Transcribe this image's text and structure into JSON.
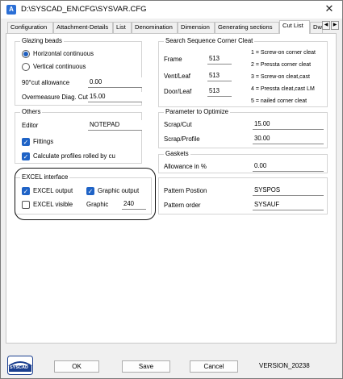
{
  "window": {
    "title": "D:\\SYSCAD_EN\\CFG\\SYSVAR.CFG"
  },
  "tabs": [
    "Configuration",
    "Attachment-Details",
    "List",
    "Denomination",
    "Dimension",
    "Generating sections",
    "Cut List",
    "Dw"
  ],
  "active_tab": "Cut List",
  "glazing_beads": {
    "title": "Glazing beads",
    "horizontal": "Horizontal continuous",
    "vertical": "Vertical continuous",
    "selected": "Horizontal continuous",
    "cut_label": "90°cut allowance",
    "cut_value": "0.00",
    "overmeasure_label": "Overmeasure Diag. Cut",
    "overmeasure_value": "15.00"
  },
  "corner_cleat": {
    "title": "Search Sequence Corner Cleat",
    "frame_label": "Frame",
    "frame_value": "513",
    "vent_label": "Vent/Leaf",
    "vent_value": "513",
    "door_label": "Door/Leaf",
    "door_value": "513",
    "legend": [
      "1 = Screw-on corner cleat",
      "2 = Pressta corner cleat",
      "3 = Screw-on cleat,cast",
      "4 = Pressta cleat,cast LM",
      "5 = nailed corner cleat"
    ]
  },
  "others": {
    "title": "Others",
    "editor_label": "Editor",
    "editor_value": "NOTEPAD",
    "fittings": "Fittings",
    "fittings_checked": true,
    "calc_profiles": "Calculate profiles rolled by cu",
    "calc_profiles_checked": true
  },
  "optimize": {
    "title": "Parameter to Optimize",
    "scrap_cut_label": "Scrap/Cut",
    "scrap_cut_value": "15.00",
    "scrap_profile_label": "Scrap/Profile",
    "scrap_profile_value": "30.00"
  },
  "gaskets": {
    "title": "Gaskets",
    "allowance_label": "Allowance in %",
    "allowance_value": "0.00"
  },
  "excel": {
    "title": "EXCEL interface",
    "output": "EXCEL output",
    "output_checked": true,
    "graphic_output": "Graphic output",
    "graphic_output_checked": true,
    "visible": "EXCEL visible",
    "visible_checked": false,
    "graphic_label": "Graphic",
    "graphic_value": "240"
  },
  "pattern": {
    "position_label": "Pattern Postion",
    "position_value": "SYSPOS",
    "order_label": "Pattern order",
    "order_value": "SYSAUF"
  },
  "buttons": {
    "ok": "OK",
    "save": "Save",
    "cancel": "Cancel"
  },
  "version": "VERSION_20238",
  "logo_text": "SYSCAD"
}
